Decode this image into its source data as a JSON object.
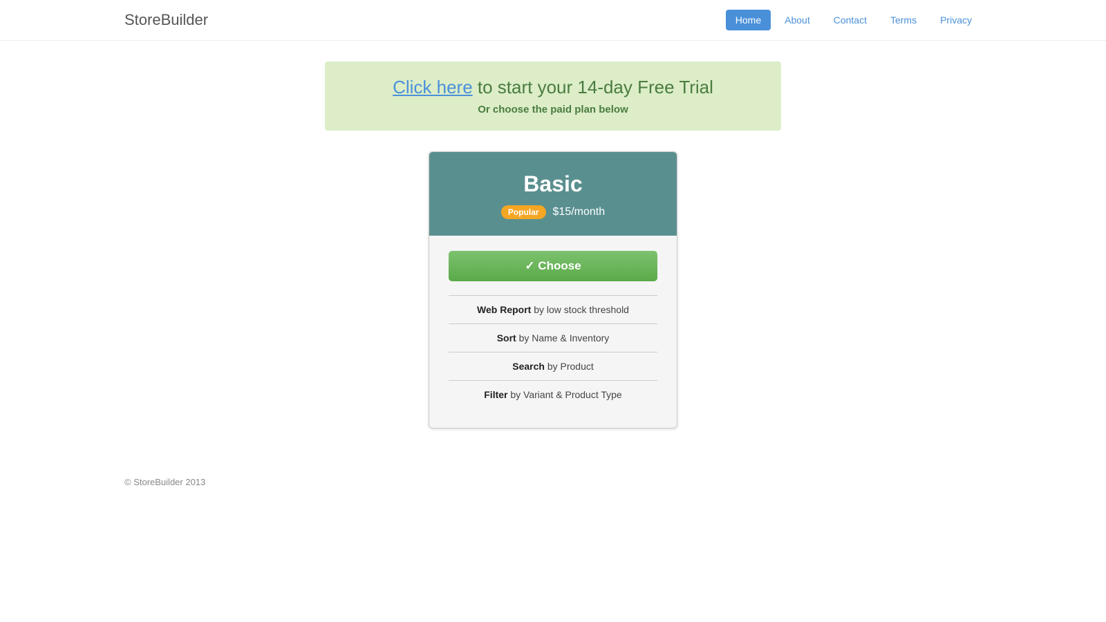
{
  "app": {
    "logo": "StoreBuilder"
  },
  "nav": {
    "links": [
      {
        "label": "Home",
        "active": true
      },
      {
        "label": "About",
        "active": false
      },
      {
        "label": "Contact",
        "active": false
      },
      {
        "label": "Terms",
        "active": false
      },
      {
        "label": "Privacy",
        "active": false
      }
    ]
  },
  "banner": {
    "link_text": "Click here",
    "text_after_link": " to start your 14-day Free Trial",
    "subtitle": "Or choose the paid plan below"
  },
  "plan": {
    "name": "Basic",
    "badge": "Popular",
    "price": "$15/month",
    "choose_label": "✓ Choose",
    "features": [
      {
        "bold": "Web Report",
        "rest": " by low stock threshold"
      },
      {
        "bold": "Sort",
        "rest": " by Name & Inventory"
      },
      {
        "bold": "Search",
        "rest": " by Product"
      },
      {
        "bold": "Filter",
        "rest": " by Variant & Product Type"
      }
    ]
  },
  "footer": {
    "text": "© StoreBuilder 2013"
  }
}
